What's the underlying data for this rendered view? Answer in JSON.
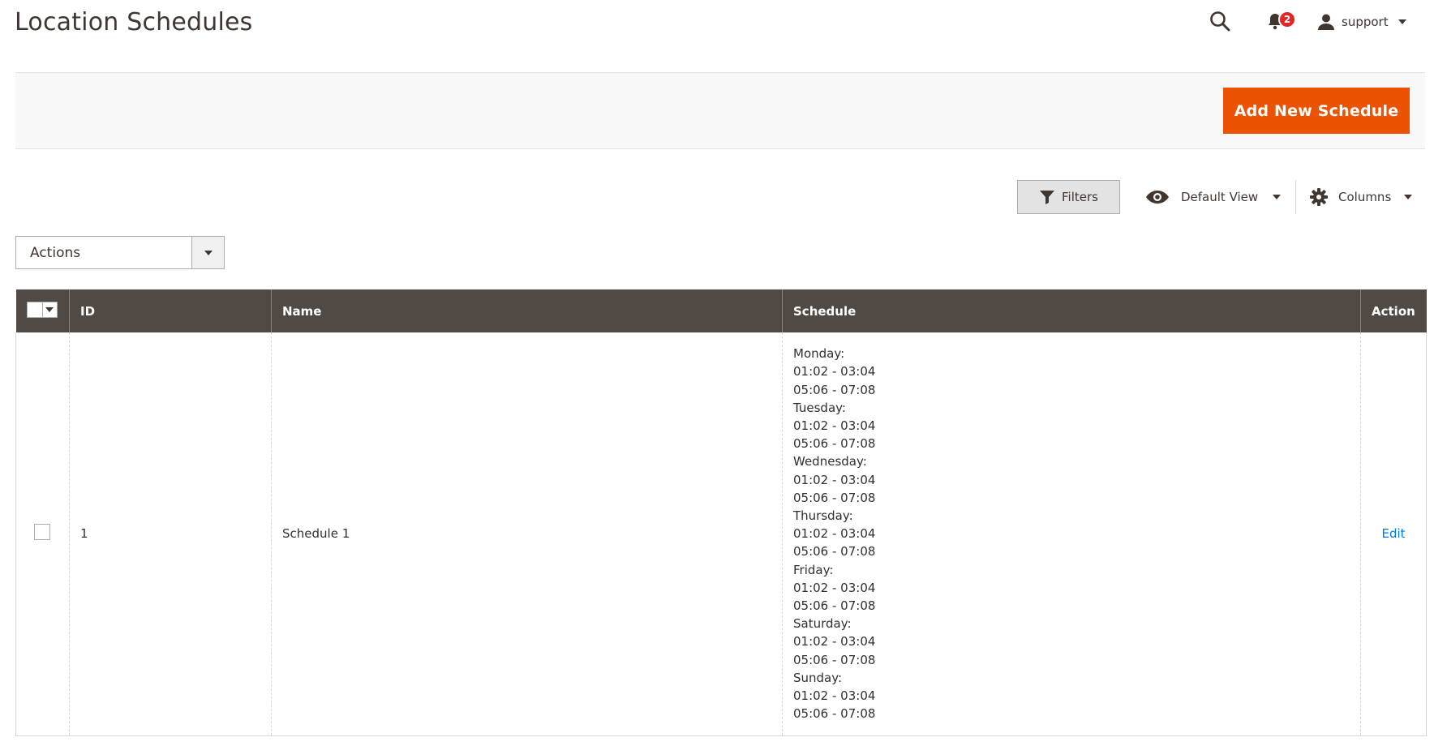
{
  "header": {
    "title": "Location Schedules",
    "notifications_count": "2",
    "user_name": "support"
  },
  "page_actions": {
    "add_button_label": "Add New Schedule"
  },
  "toolbar": {
    "filters_label": "Filters",
    "view_label": "Default View",
    "columns_label": "Columns"
  },
  "mass_actions": {
    "selected": "Actions"
  },
  "grid": {
    "columns": [
      "ID",
      "Name",
      "Schedule",
      "Action"
    ],
    "rows": [
      {
        "id": "1",
        "name": "Schedule 1",
        "schedule": [
          "Monday:",
          "01:02 - 03:04",
          "05:06 - 07:08",
          "Tuesday:",
          "01:02 - 03:04",
          "05:06 - 07:08",
          "Wednesday:",
          "01:02 - 03:04",
          "05:06 - 07:08",
          "Thursday:",
          "01:02 - 03:04",
          "05:06 - 07:08",
          "Friday:",
          "01:02 - 03:04",
          "05:06 - 07:08",
          "Saturday:",
          "01:02 - 03:04",
          "05:06 - 07:08",
          "Sunday:",
          "01:02 - 03:04",
          "05:06 - 07:08"
        ],
        "action": "Edit"
      }
    ]
  },
  "icons": {
    "search": "search-icon",
    "notifications": "bell-icon",
    "user": "user-icon",
    "filters": "funnel-icon",
    "view": "eye-icon",
    "columns": "gear-icon"
  },
  "colors": {
    "accent": "#eb5202",
    "grid_header": "#514943",
    "link": "#007bdb",
    "badge": "#e22626"
  }
}
